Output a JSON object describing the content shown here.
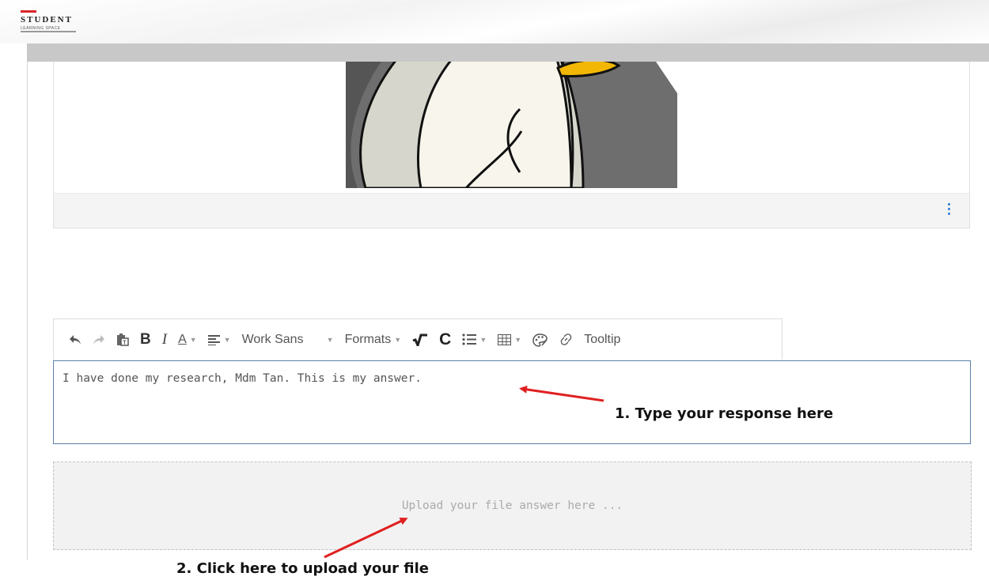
{
  "header": {
    "logo_title": "STUDENT",
    "logo_subtitle": "LEARNING SPACE"
  },
  "toolbar": {
    "font_name": "Work Sans",
    "formats_label": "Formats",
    "tooltip_label": "Tooltip",
    "bold_label": "B",
    "italic_label": "I",
    "text_color_label": "A",
    "c_label": "C"
  },
  "response": {
    "text": "I have done my research, Mdm Tan. This is my answer."
  },
  "upload": {
    "placeholder": "Upload your file answer here ..."
  },
  "annotations": {
    "step1": "1. Type your response here",
    "step2": "2. Click here to upload your file"
  },
  "colors": {
    "accent_blue": "#2a7bd3",
    "arrow_red": "#e02020",
    "logo_red": "#d9262b",
    "textbox_border": "#5c7fa8"
  }
}
